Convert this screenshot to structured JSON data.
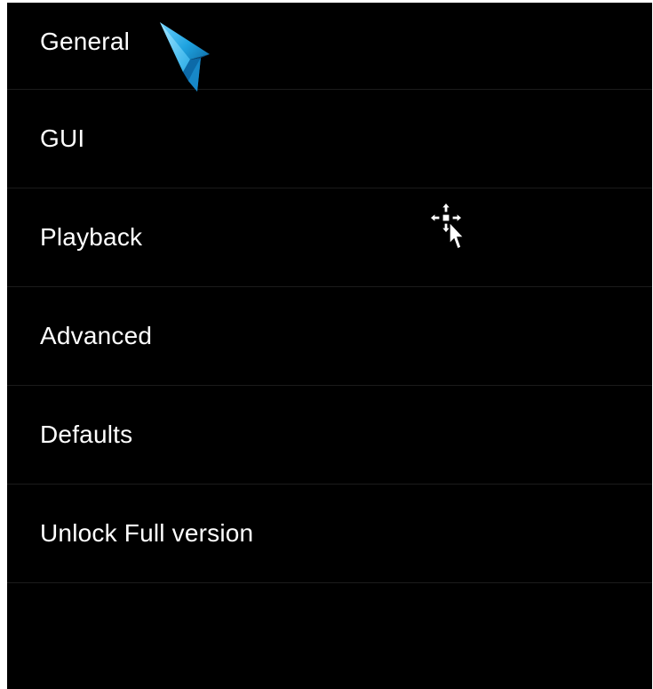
{
  "settings_menu": {
    "items": [
      {
        "label": "General"
      },
      {
        "label": "GUI"
      },
      {
        "label": "Playback"
      },
      {
        "label": "Advanced"
      },
      {
        "label": "Defaults"
      },
      {
        "label": "Unlock Full version"
      }
    ]
  },
  "icons": {
    "selection_pointer": "blue-arrow-pointer-icon",
    "mouse_cursor": "move-arrow-cursor-icon"
  },
  "colors": {
    "background": "#000000",
    "text": "#ffffff",
    "divider": "#1b1b1b",
    "pointer_accent": "#1fa3e0"
  }
}
